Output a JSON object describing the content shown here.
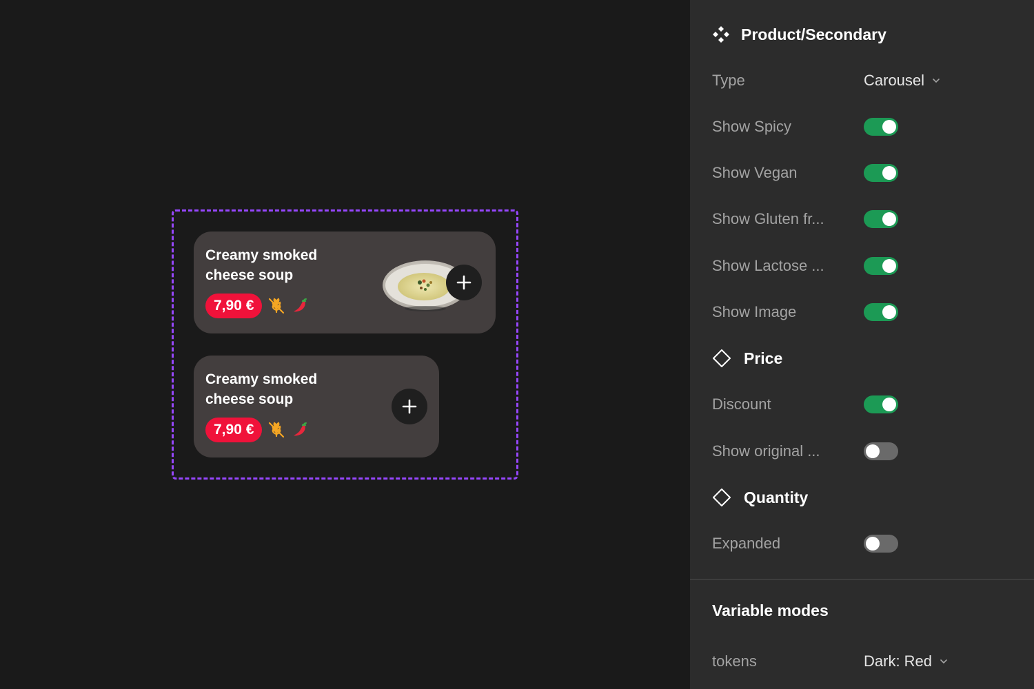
{
  "canvas": {
    "cards": [
      {
        "title_line1": "Creamy smoked",
        "title_line2": "cheese soup",
        "price": "7,90 €",
        "has_image": true
      },
      {
        "title_line1": "Creamy smoked",
        "title_line2": "cheese soup",
        "price": "7,90 €",
        "has_image": false
      }
    ],
    "selection_color": "#9747ff",
    "price_badge_color": "#f0123a"
  },
  "panel": {
    "component_name": "Product/Secondary",
    "properties": [
      {
        "label": "Type",
        "value": "Carousel",
        "kind": "dropdown"
      },
      {
        "label": "Show Spicy",
        "kind": "toggle",
        "on": true
      },
      {
        "label": "Show Vegan",
        "kind": "toggle",
        "on": true
      },
      {
        "label": "Show Gluten fr...",
        "kind": "toggle",
        "on": true
      },
      {
        "label": "Show Lactose ...",
        "kind": "toggle",
        "on": true
      },
      {
        "label": "Show Image",
        "kind": "toggle",
        "on": true
      }
    ],
    "price_section": {
      "title": "Price",
      "properties": [
        {
          "label": "Discount",
          "kind": "toggle",
          "on": true
        },
        {
          "label": "Show original ...",
          "kind": "toggle",
          "on": false
        }
      ]
    },
    "quantity_section": {
      "title": "Quantity",
      "properties": [
        {
          "label": "Expanded",
          "kind": "toggle",
          "on": false
        }
      ]
    },
    "variable_modes": {
      "title": "Variable modes",
      "rows": [
        {
          "label": "tokens",
          "value": "Dark: Red"
        }
      ]
    },
    "toggle_on_color": "#1c9a55",
    "toggle_off_color": "#6a6a6a"
  }
}
